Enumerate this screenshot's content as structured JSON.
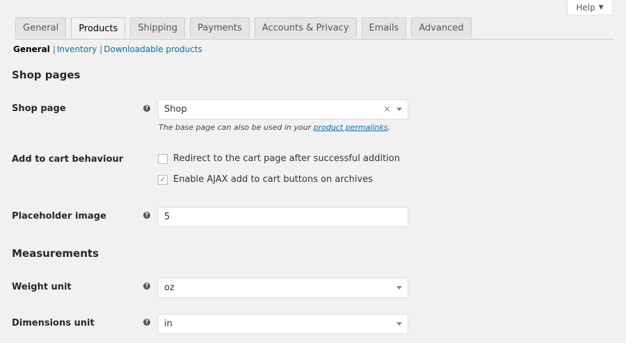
{
  "help": {
    "label": "Help"
  },
  "tabs": [
    {
      "label": "General"
    },
    {
      "label": "Products",
      "active": true
    },
    {
      "label": "Shipping"
    },
    {
      "label": "Payments"
    },
    {
      "label": "Accounts & Privacy"
    },
    {
      "label": "Emails"
    },
    {
      "label": "Advanced"
    }
  ],
  "subnav": {
    "current": "General",
    "inventory": "Inventory",
    "downloadable": "Downloadable products"
  },
  "shop_pages": {
    "heading": "Shop pages",
    "shop_page": {
      "label": "Shop page",
      "value": "Shop",
      "desc_prefix": "The base page can also be used in your ",
      "desc_link": "product permalinks",
      "desc_suffix": "."
    },
    "add_to_cart": {
      "label": "Add to cart behaviour",
      "option1": "Redirect to the cart page after successful addition",
      "option1_checked": false,
      "option2": "Enable AJAX add to cart buttons on archives",
      "option2_checked": true
    },
    "placeholder": {
      "label": "Placeholder image",
      "value": "5"
    }
  },
  "measurements": {
    "heading": "Measurements",
    "weight": {
      "label": "Weight unit",
      "value": "oz"
    },
    "dimensions": {
      "label": "Dimensions unit",
      "value": "in"
    }
  }
}
